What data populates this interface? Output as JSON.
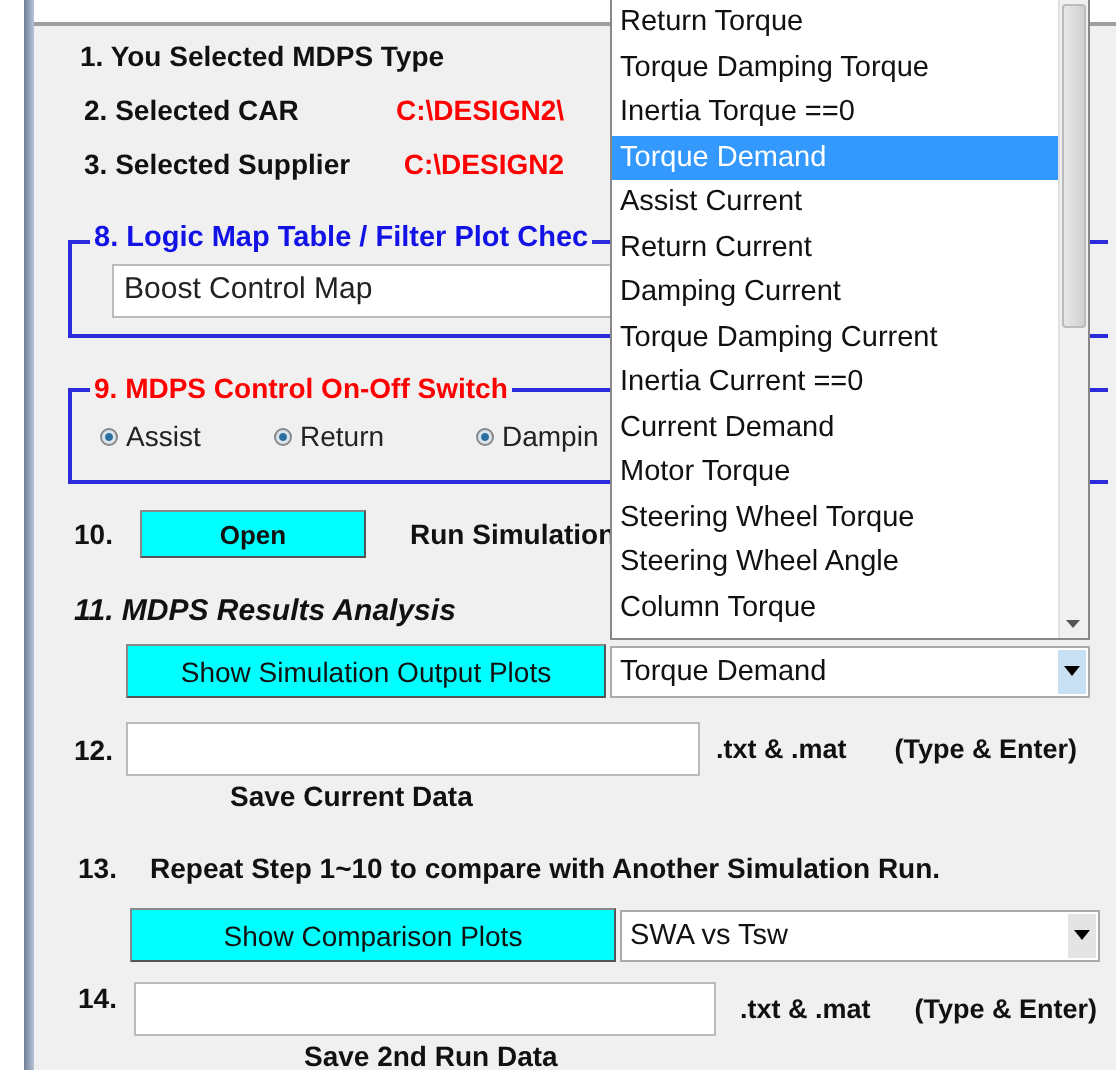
{
  "steps": [
    {
      "label": "1. You Selected MDPS Type"
    },
    {
      "label": "2. Selected  CAR",
      "path": "C:\\DESIGN2\\"
    },
    {
      "label": "3. Selected Supplier",
      "path": "C:\\DESIGN2"
    }
  ],
  "logic_map": {
    "title": "8. Logic Map Table / Filter Plot Chec",
    "value": "Boost Control Map"
  },
  "control_switch": {
    "title": "9. MDPS Control  On-Off Switch",
    "options": [
      {
        "label": "Assist",
        "checked": true
      },
      {
        "label": "Return",
        "checked": true
      },
      {
        "label": "Dampin",
        "checked": true
      }
    ]
  },
  "run": {
    "number": "10.",
    "button": "Open",
    "label": "Run Simulation"
  },
  "analysis": {
    "title": "11. MDPS  Results  Analysis",
    "button": "Show Simulation Output Plots",
    "dropdown": {
      "value": "Torque Demand",
      "expanded": true,
      "options": [
        {
          "label": "Return Torque",
          "selected": false
        },
        {
          "label": "Torque Damping Torque",
          "selected": false
        },
        {
          "label": "Inertia Torque ==0",
          "selected": false
        },
        {
          "label": "Torque Demand",
          "selected": true
        },
        {
          "label": "Assist Current",
          "selected": false
        },
        {
          "label": "Return Current",
          "selected": false
        },
        {
          "label": "Damping Current",
          "selected": false
        },
        {
          "label": "Torque Damping Current",
          "selected": false
        },
        {
          "label": "Inertia Current ==0",
          "selected": false
        },
        {
          "label": "Current Demand",
          "selected": false
        },
        {
          "label": "Motor Torque",
          "selected": false
        },
        {
          "label": "Steering Wheel Torque",
          "selected": false
        },
        {
          "label": "Steering Wheel Angle",
          "selected": false
        },
        {
          "label": "Column Torque",
          "selected": false
        }
      ]
    }
  },
  "save_current": {
    "number": "12.",
    "ext": ".txt & .mat",
    "hint": "(Type & Enter)",
    "caption": "Save Current Data"
  },
  "compare": {
    "number": "13.",
    "text": "Repeat Step 1~10 to compare with Another Simulation Run.",
    "button": "Show Comparison Plots",
    "dropdown": {
      "value": "SWA vs Tsw"
    }
  },
  "save_second": {
    "number": "14.",
    "ext": ".txt & .mat",
    "hint": "(Type & Enter)",
    "caption": "Save 2nd Run Data"
  }
}
